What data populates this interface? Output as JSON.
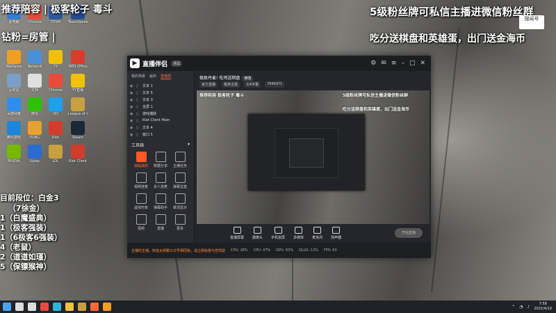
{
  "overlay": {
    "top_left": "推荐陪容 | 极客轮子 毒斗",
    "left_second": "钻粉=房管 |",
    "rank_title": "目前段位：白金3",
    "list": [
      "（7徐金）",
      "1（白魔盛典）",
      "1（极客强装）",
      "1（6极客6强装）",
      "4（老鼠）",
      "2（道道如瑾）",
      "5（保镖猴神）"
    ],
    "top_right": "5级粉丝牌可私信主播进微信粉丝群",
    "right_second": "吃分送棋盘和英雄蛋，出门送金海币",
    "badge": "搜闻号"
  },
  "desktop": {
    "icons": [
      {
        "label": "此电脑",
        "color": "#3b7bd4"
      },
      {
        "label": "Chrome",
        "color": "#e84a3c"
      },
      {
        "label": "TGVM",
        "color": "#2a5a9e"
      },
      {
        "label": "TeamSpeak",
        "color": "#244b8f"
      },
      {
        "label": "WeGame",
        "color": "#f0a020"
      },
      {
        "label": "Network",
        "color": "#4a90d9"
      },
      {
        "label": "YY",
        "color": "#f2c200"
      },
      {
        "label": "WPS Office",
        "color": "#d93c2c"
      },
      {
        "label": "回收站",
        "color": "#7aa0c8"
      },
      {
        "label": "文档",
        "color": "#e0e0e0"
      },
      {
        "label": "Chrome",
        "color": "#e84a3c"
      },
      {
        "label": "YY直播",
        "color": "#f2c200"
      },
      {
        "label": "百度网盘",
        "color": "#2e8ef0"
      },
      {
        "label": "微信",
        "color": "#2dc100"
      },
      {
        "label": "QQ",
        "color": "#1ea0f0"
      },
      {
        "label": "League of Legends",
        "color": "#c8a040"
      },
      {
        "label": "腾讯游戏",
        "color": "#1e86d8"
      },
      {
        "label": "PUBG",
        "color": "#e8a030"
      },
      {
        "label": "Riot",
        "color": "#d23c2c"
      },
      {
        "label": "Steam",
        "color": "#1b2838"
      },
      {
        "label": "NVIDIA",
        "color": "#76b900"
      },
      {
        "label": "Uplay",
        "color": "#2a6cd0"
      },
      {
        "label": "LOL",
        "color": "#c8a040"
      },
      {
        "label": "Riot Client",
        "color": "#d23c2c"
      }
    ]
  },
  "app": {
    "name": "直播伴侣",
    "version": "测试",
    "left_tabs": [
      "我的场景",
      "画布",
      "直播源"
    ],
    "scenes": [
      "文本 1",
      "文本 5",
      "文本 3",
      "全屏 1",
      "游戏捕获",
      "Riot Client Main",
      "文本 4",
      "窗口 5"
    ],
    "tools_title": "工具箱",
    "tools": [
      "抽幅抽奖",
      "数据分享",
      "主播任务",
      "视频连麦",
      "多人连麦",
      "弹幕宝盒",
      "虚拟形象",
      "弹幕助手",
      "歌词显示",
      "视频",
      "直播",
      "更多"
    ],
    "room_title": "极致丹麦! 吃鸡送棋盘",
    "room_tag": "修改",
    "room_meta": [
      "官方直播",
      "极简主题",
      "3/4字幕",
      "7846971"
    ],
    "preview_texts": {
      "top_left": "推荐陪容 极客轮子 毒斗",
      "right_1": "5级粉丝牌可私信主播进微信粉丝群",
      "right_2": "吃分送棋盘和英雄蛋，出门送金海币"
    },
    "controls": [
      "直播屏幕",
      "摄像头",
      "手机投屏",
      "多媒体",
      "麦克风",
      "扬声器"
    ],
    "start_label": "开始直播",
    "status": {
      "warning": "主播的主播，知道太频繁公众号相同级，请立即给我与您驾驶",
      "items": [
        "CPU: 28%",
        "CPU: 47%",
        "GPU: 63%",
        "DLUX: 12%",
        "FPS: 60"
      ]
    }
  },
  "taskbar": {
    "apps": [
      "开始",
      "搜索",
      "任务视图",
      "Chrome",
      "Edge",
      "文件夹",
      "LoL",
      "直播伴侣",
      "WeGame"
    ],
    "time": "7:58",
    "date": "2022/4/10"
  }
}
